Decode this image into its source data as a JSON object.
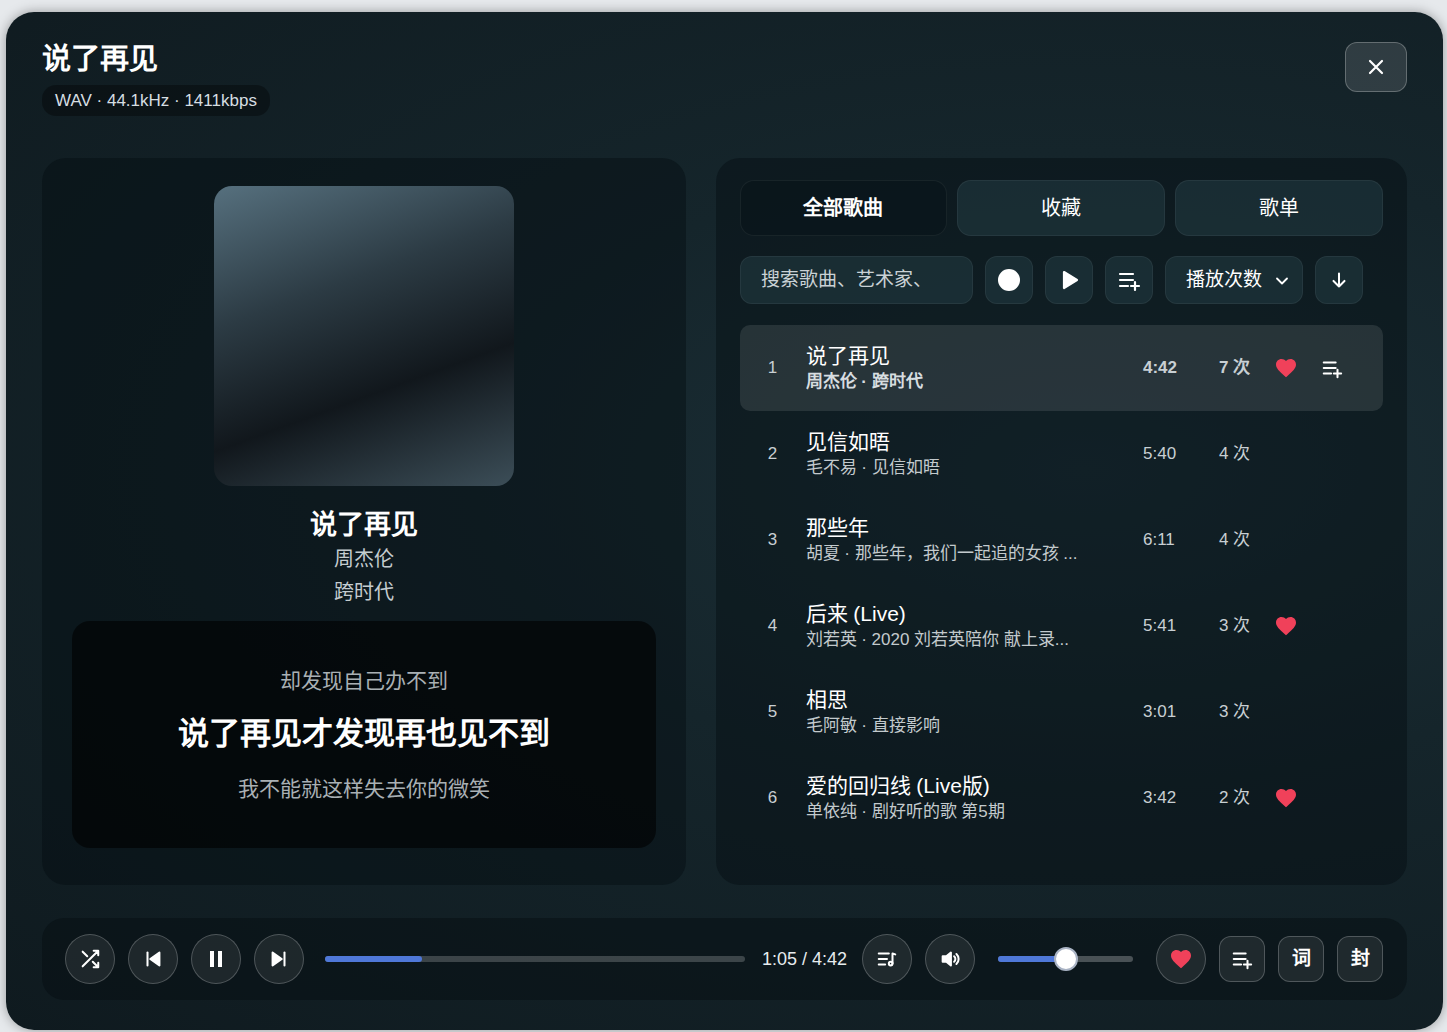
{
  "window": {
    "title": "说了再见",
    "format": "WAV · 44.1kHz · 1411kbps"
  },
  "now_playing": {
    "title": "说了再见",
    "artist": "周杰伦",
    "album": "跨时代"
  },
  "lyrics": [
    {
      "text": "却发现自己办不到",
      "selected": false
    },
    {
      "text": "说了再见才发现再也见不到",
      "selected": true
    },
    {
      "text": "我不能就这样失去你的微笑",
      "selected": false
    }
  ],
  "tabs": [
    {
      "label": "全部歌曲",
      "selected": true
    },
    {
      "label": "收藏",
      "selected": false
    },
    {
      "label": "歌单",
      "selected": false
    }
  ],
  "toolbar": {
    "search_placeholder": "搜索歌曲、艺术家、",
    "sort": "播放次数"
  },
  "songs": [
    {
      "index": "1",
      "title": "说了再见",
      "subtitle": "周杰伦 · 跨时代",
      "duration": "4:42",
      "plays": "7 次",
      "liked": true,
      "selected": true
    },
    {
      "index": "2",
      "title": "见信如晤",
      "subtitle": "毛不易 · 见信如晤",
      "duration": "5:40",
      "plays": "4 次",
      "liked": false,
      "selected": false
    },
    {
      "index": "3",
      "title": "那些年",
      "subtitle": "胡夏 · 那些年，我们一起追的女孩 ...",
      "duration": "6:11",
      "plays": "4 次",
      "liked": false,
      "selected": false
    },
    {
      "index": "4",
      "title": "后来 (Live)",
      "subtitle": "刘若英 · 2020 刘若英陪你 献上录...",
      "duration": "5:41",
      "plays": "3 次",
      "liked": true,
      "selected": false
    },
    {
      "index": "5",
      "title": "相思",
      "subtitle": "毛阿敏 · 直接影响",
      "duration": "3:01",
      "plays": "3 次",
      "liked": false,
      "selected": false
    },
    {
      "index": "6",
      "title": "爱的回归线 (Live版)",
      "subtitle": "单依纯 · 剧好听的歌 第5期",
      "duration": "3:42",
      "plays": "2 次",
      "liked": true,
      "selected": false
    }
  ],
  "player": {
    "playing": true,
    "progress": 0.23,
    "time": "1:05 / 4:42",
    "volume": 0.5,
    "liked": true,
    "lyrics_button": "词",
    "cover_button": "封"
  }
}
